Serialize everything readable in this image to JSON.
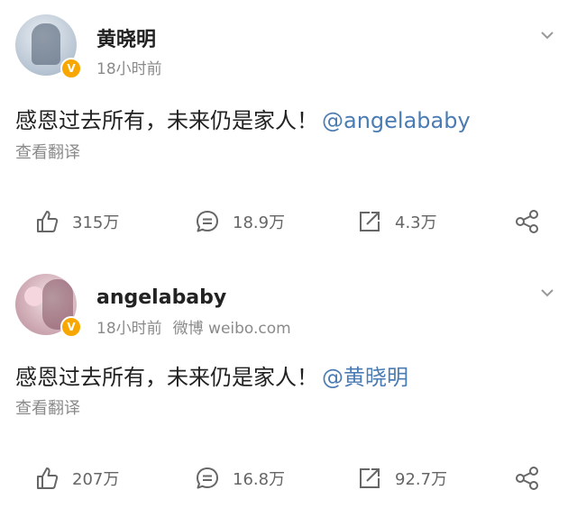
{
  "posts": [
    {
      "username": "黄晓明",
      "time": "18小时前",
      "source": "",
      "text": "感恩过去所有，未来仍是家人！",
      "mention": "@angelababy",
      "translate": "查看翻译",
      "verified_badge": "V",
      "likes": "315万",
      "comments": "18.9万",
      "reposts": "4.3万"
    },
    {
      "username": "angelababy",
      "time": "18小时前",
      "source": "微博 weibo.com",
      "text": "感恩过去所有，未来仍是家人！",
      "mention": "@黄晓明",
      "translate": "查看翻译",
      "verified_badge": "V",
      "likes": "207万",
      "comments": "16.8万",
      "reposts": "92.7万"
    }
  ],
  "colors": {
    "mention": "#4a7cb3",
    "meta": "#8a8a8a",
    "verified": "#f7a700"
  },
  "icons": [
    "like-icon",
    "comment-icon",
    "repost-icon",
    "share-icon",
    "chevron-down-icon",
    "verified-badge-icon"
  ]
}
